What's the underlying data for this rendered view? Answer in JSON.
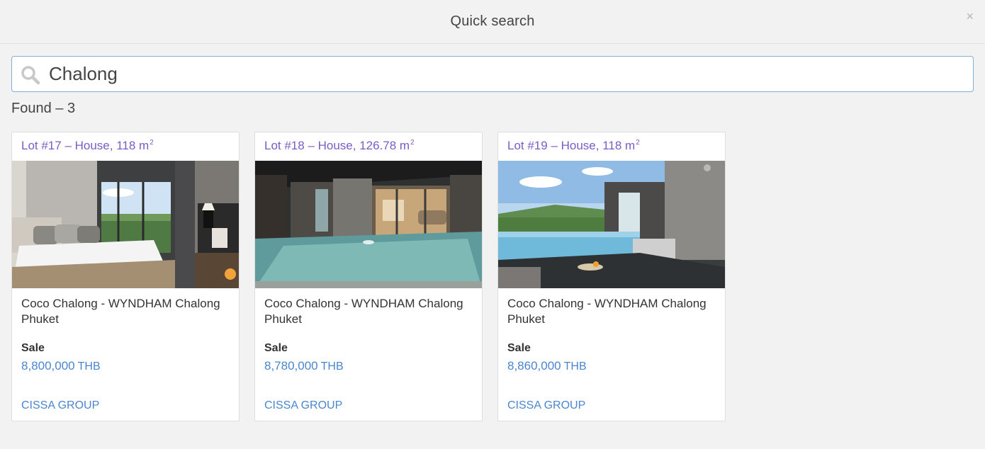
{
  "header": {
    "title": "Quick search",
    "close_label": "×"
  },
  "search": {
    "value": "Chalong",
    "icon": "search-icon"
  },
  "results": {
    "found_text": "Found – 3"
  },
  "cards": [
    {
      "lot": "Lot #17 – House, 118 m",
      "unit_sup": "2",
      "photo": "bedroom-photo",
      "name": "Coco Chalong - WYNDHAM Chalong Phuket",
      "sale_label": "Sale",
      "price": "8,800,000",
      "currency": "THB",
      "agent": "CISSA GROUP"
    },
    {
      "lot": "Lot #18 – House, 126.78 m",
      "unit_sup": "2",
      "photo": "night-pool-photo",
      "name": "Coco Chalong - WYNDHAM Chalong Phuket",
      "sale_label": "Sale",
      "price": "8,780,000",
      "currency": "THB",
      "agent": "CISSA GROUP"
    },
    {
      "lot": "Lot #19 – House, 118 m",
      "unit_sup": "2",
      "photo": "day-pool-photo",
      "name": "Coco Chalong - WYNDHAM Chalong Phuket",
      "sale_label": "Sale",
      "price": "8,860,000",
      "currency": "THB",
      "agent": "CISSA GROUP"
    }
  ],
  "colors": {
    "title_purple": "#7a5cc8",
    "link_blue": "#4a86cf",
    "search_border": "#7fb0d6"
  }
}
